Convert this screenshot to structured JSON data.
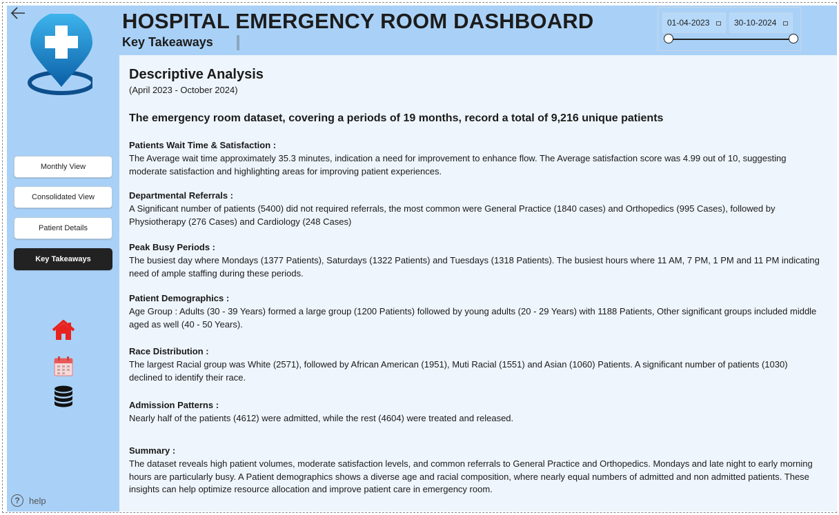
{
  "header": {
    "title": "HOSPITAL EMERGENCY ROOM DASHBOARD",
    "subtitle": "Key Takeaways"
  },
  "date_slicer": {
    "start": "01-04-2023",
    "end": "30-10-2024"
  },
  "sidebar": {
    "nav": [
      {
        "label": "Monthly View"
      },
      {
        "label": "Consolidated View"
      },
      {
        "label": "Patient Details"
      },
      {
        "label": "Key Takeaways",
        "active": true
      }
    ],
    "icons": [
      "home-icon",
      "calendar-icon",
      "database-icon"
    ],
    "help_label": "help"
  },
  "content": {
    "heading": "Descriptive Analysis",
    "range": "(April 2023 - October 2024)",
    "lead": "The emergency room dataset, covering a periods of 19 months, record a total of 9,216 unique patients",
    "sections": [
      {
        "title": "Patients Wait Time & Satisfaction :",
        "body": "The Average wait time approximately 35.3 minutes, indication a need for improvement to enhance flow. The Average satisfaction score was 4.99 out of 10, suggesting moderate satisfaction and highlighting areas for improving patient experiences."
      },
      {
        "title": "Departmental Referrals :",
        "body": "A Significant number of patients (5400) did not required referrals, the most common were General Practice (1840 cases) and Orthopedics (995 Cases), followed by Physiotherapy (276 Cases) and Cardiology (248 Cases)"
      },
      {
        "title": "Peak Busy Periods :",
        "body": "The busiest day where Mondays (1377 Patients), Saturdays (1322 Patients) and Tuesdays (1318 Patients). The busiest hours where 11 AM, 7 PM, 1 PM and 11 PM indicating need of ample staffing during these periods."
      },
      {
        "title": "Patient Demographics :",
        "body": "Age Group : Adults (30 - 39 Years) formed a large group (1200 Patients) followed by young adults (20 - 29 Years) with 1188 Patients, Other significant groups included middle aged as well (40 - 50 Years)."
      },
      {
        "title": "Race Distribution :",
        "body": "The largest Racial group was White (2571), followed by African American (1951), Muti Racial (1551) and Asian (1060) Patients. A significant number of patients (1030) declined to identify their race."
      },
      {
        "title": "Admission Patterns  :",
        "body": "Nearly half of the patients (4612) were admitted, while the rest (4604) were treated and released."
      },
      {
        "title": "Summary :",
        "body": "The dataset reveals high patient volumes, moderate satisfaction levels, and common referrals to General Practice and Orthopedics. Mondays and late night to early morning hours are particularly busy. A Patient demographics shows a diverse age and racial composition, where nearly equal numbers of admitted and non admitted patients. These insights can help optimize resource allocation and improve patient care in emergency room."
      }
    ]
  },
  "colors": {
    "panel": "#a9d1f7",
    "content_bg": "#eef5fc",
    "active_nav": "#222222",
    "logo_blue": "#1a8fd0",
    "home_red": "#e8231f"
  }
}
